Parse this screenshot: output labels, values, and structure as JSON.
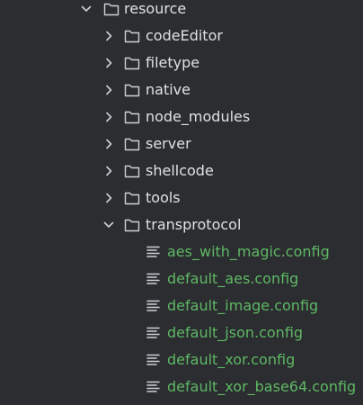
{
  "colors": {
    "background": "#2b2d30",
    "text": "#dfe1e5",
    "config_text": "#5fb865",
    "icon": "#ced0d6"
  },
  "tree": {
    "root": {
      "label": "resource",
      "expanded": true,
      "icon": "folder-icon"
    },
    "folders": [
      {
        "label": "codeEditor",
        "expanded": false,
        "icon": "folder-icon"
      },
      {
        "label": "filetype",
        "expanded": false,
        "icon": "folder-icon"
      },
      {
        "label": "native",
        "expanded": false,
        "icon": "folder-icon"
      },
      {
        "label": "node_modules",
        "expanded": false,
        "icon": "folder-icon"
      },
      {
        "label": "server",
        "expanded": false,
        "icon": "folder-icon"
      },
      {
        "label": "shellcode",
        "expanded": false,
        "icon": "folder-icon"
      },
      {
        "label": "tools",
        "expanded": false,
        "icon": "folder-icon"
      },
      {
        "label": "transprotocol",
        "expanded": true,
        "icon": "folder-icon"
      }
    ],
    "files": [
      {
        "label": "aes_with_magic.config",
        "icon": "text-file-icon"
      },
      {
        "label": "default_aes.config",
        "icon": "text-file-icon"
      },
      {
        "label": "default_image.config",
        "icon": "text-file-icon"
      },
      {
        "label": "default_json.config",
        "icon": "text-file-icon"
      },
      {
        "label": "default_xor.config",
        "icon": "text-file-icon"
      },
      {
        "label": "default_xor_base64.config",
        "icon": "text-file-icon"
      }
    ]
  }
}
